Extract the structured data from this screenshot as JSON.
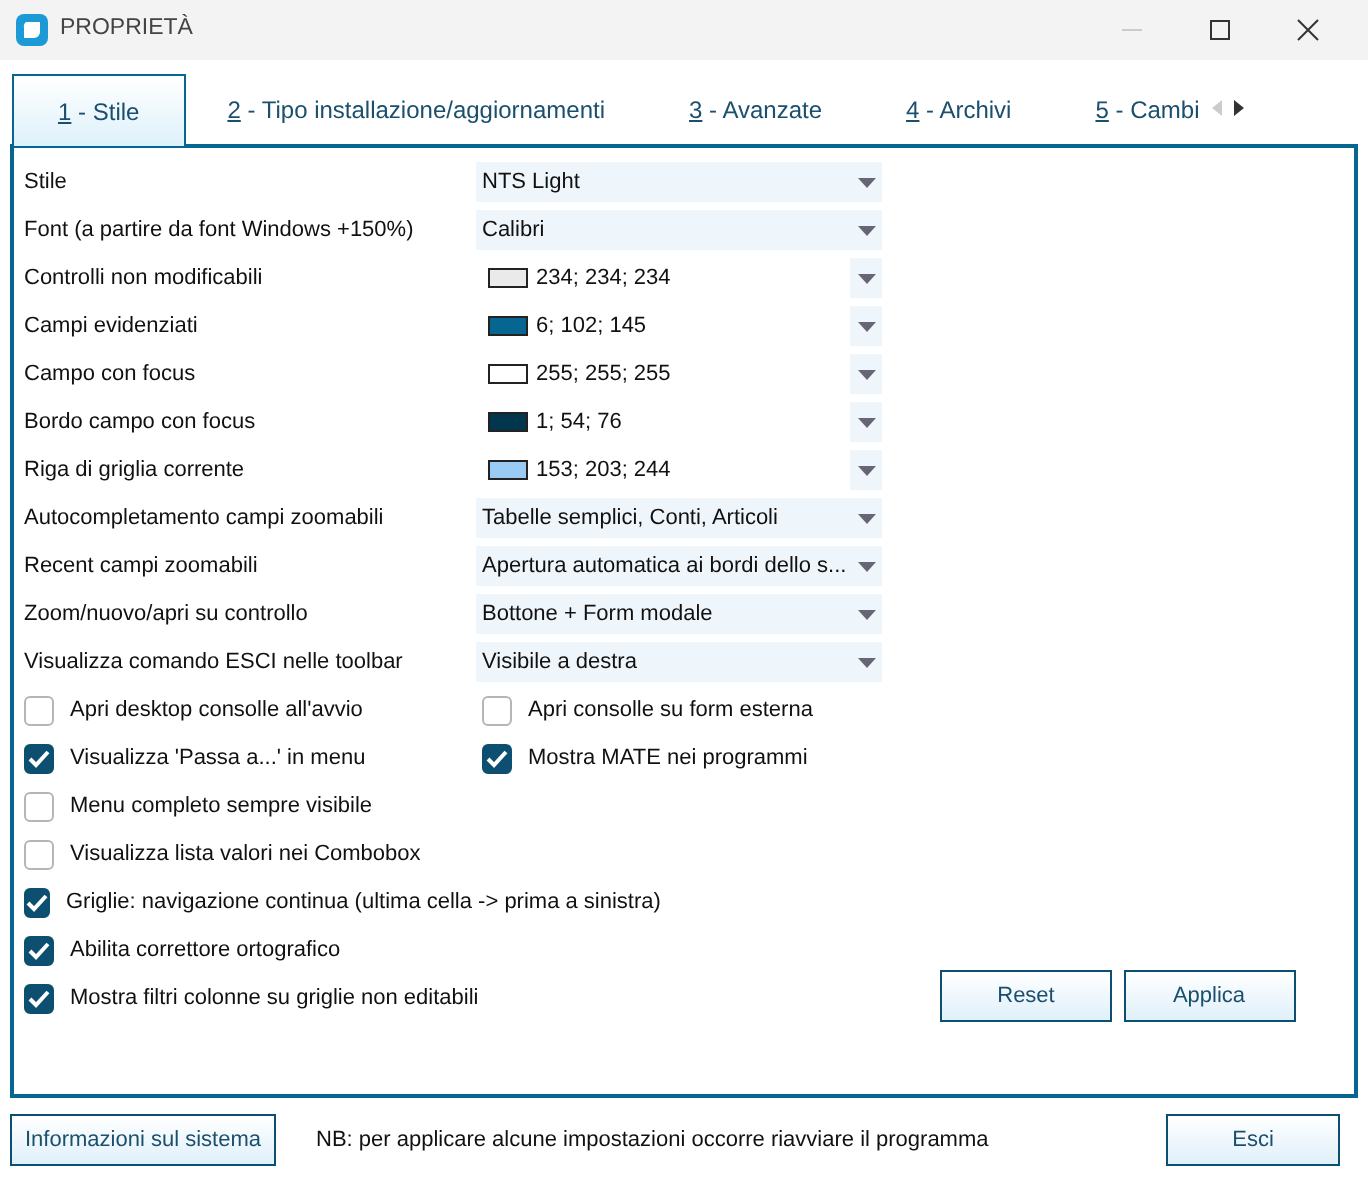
{
  "window": {
    "title": "PROPRIETÀ"
  },
  "tabs": [
    {
      "key": "1",
      "label": "- Stile",
      "selected": true
    },
    {
      "key": "2",
      "label": "- Tipo installazione/aggiornamenti",
      "selected": false
    },
    {
      "key": "3",
      "label": "- Avanzate",
      "selected": false
    },
    {
      "key": "4",
      "label": "- Archivi",
      "selected": false
    },
    {
      "key": "5",
      "label": "- Cambi",
      "selected": false
    }
  ],
  "tab_scroll": [
    {
      "kind": "left",
      "disabled": true
    },
    {
      "kind": "right",
      "disabled": false
    }
  ],
  "settings": [
    {
      "kind": "combo",
      "label": "Stile",
      "value": "NTS Light"
    },
    {
      "kind": "combo",
      "label": "Font (a partire da font Windows +150%)",
      "value": "Calibri"
    },
    {
      "kind": "color",
      "label": "Controlli non modificabili",
      "value": "234; 234; 234",
      "color": "#eaeaea"
    },
    {
      "kind": "color",
      "label": "Campi evidenziati",
      "value": "6; 102; 145",
      "color": "#066691"
    },
    {
      "kind": "color",
      "label": "Campo con focus",
      "value": "255; 255; 255",
      "color": "#ffffff"
    },
    {
      "kind": "color",
      "label": "Bordo campo con focus",
      "value": "1; 54; 76",
      "color": "#01364c"
    },
    {
      "kind": "color",
      "label": "Riga di griglia corrente",
      "value": "153; 203; 244",
      "color": "#99cbf4"
    },
    {
      "kind": "combo",
      "label": "Autocompletamento campi zoomabili",
      "value": "Tabelle semplici, Conti, Articoli"
    },
    {
      "kind": "combo",
      "label": "Recent campi zoomabili",
      "value": "Apertura automatica ai bordi dello s..."
    },
    {
      "kind": "combo",
      "label": "Zoom/nuovo/apri su controllo",
      "value": "Bottone + Form modale"
    },
    {
      "kind": "combo",
      "label": "Visualizza comando ESCI nelle toolbar",
      "value": "Visibile a destra"
    }
  ],
  "checkbox_rows": [
    [
      {
        "label": "Apri desktop consolle all'avvio",
        "checked": false
      },
      {
        "label": "Apri consolle su form esterna",
        "checked": false
      }
    ],
    [
      {
        "label": "Visualizza 'Passa a...' in menu",
        "checked": true
      },
      {
        "label": "Mostra MATE nei programmi",
        "checked": true
      }
    ],
    [
      {
        "label": "Menu completo sempre visibile",
        "checked": false
      }
    ],
    [
      {
        "label": "Visualizza lista valori nei Combobox",
        "checked": false
      }
    ],
    [
      {
        "label": "Griglie: navigazione continua (ultima cella -> prima a sinistra)",
        "checked": true
      }
    ],
    [
      {
        "label": "Abilita correttore ortografico",
        "checked": true
      }
    ],
    [
      {
        "label": "Mostra filtri colonne su griglie non editabili",
        "checked": true
      }
    ]
  ],
  "panel_buttons": [
    "Reset",
    "Applica"
  ],
  "footer": {
    "info_button": "Informazioni sul sistema",
    "note": "NB: per applicare alcune impostazioni occorre riavviare il programma",
    "close_button": "Esci"
  }
}
